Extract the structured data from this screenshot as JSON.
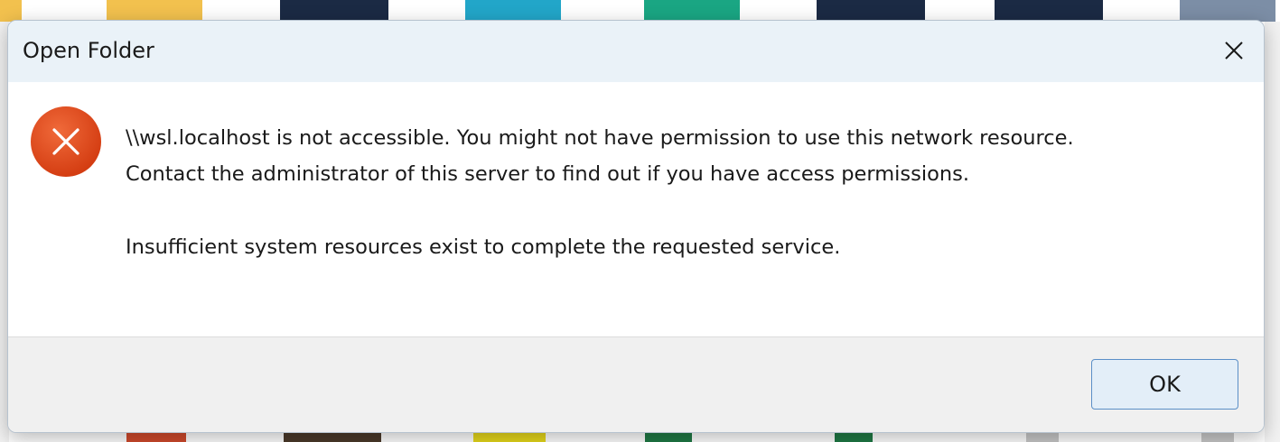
{
  "dialog": {
    "title": "Open Folder",
    "close_icon": "close-icon",
    "error_icon": "error-icon",
    "message_lines": [
      "\\\\wsl.localhost is not accessible. You might not have permission to use this network resource.",
      "Contact the administrator of this server to find out if you have access permissions."
    ],
    "detail": "Insufficient system resources exist to complete the requested service.",
    "ok_label": "OK",
    "error_color": "#e14a1e",
    "accent_color": "#5b8fc7"
  }
}
